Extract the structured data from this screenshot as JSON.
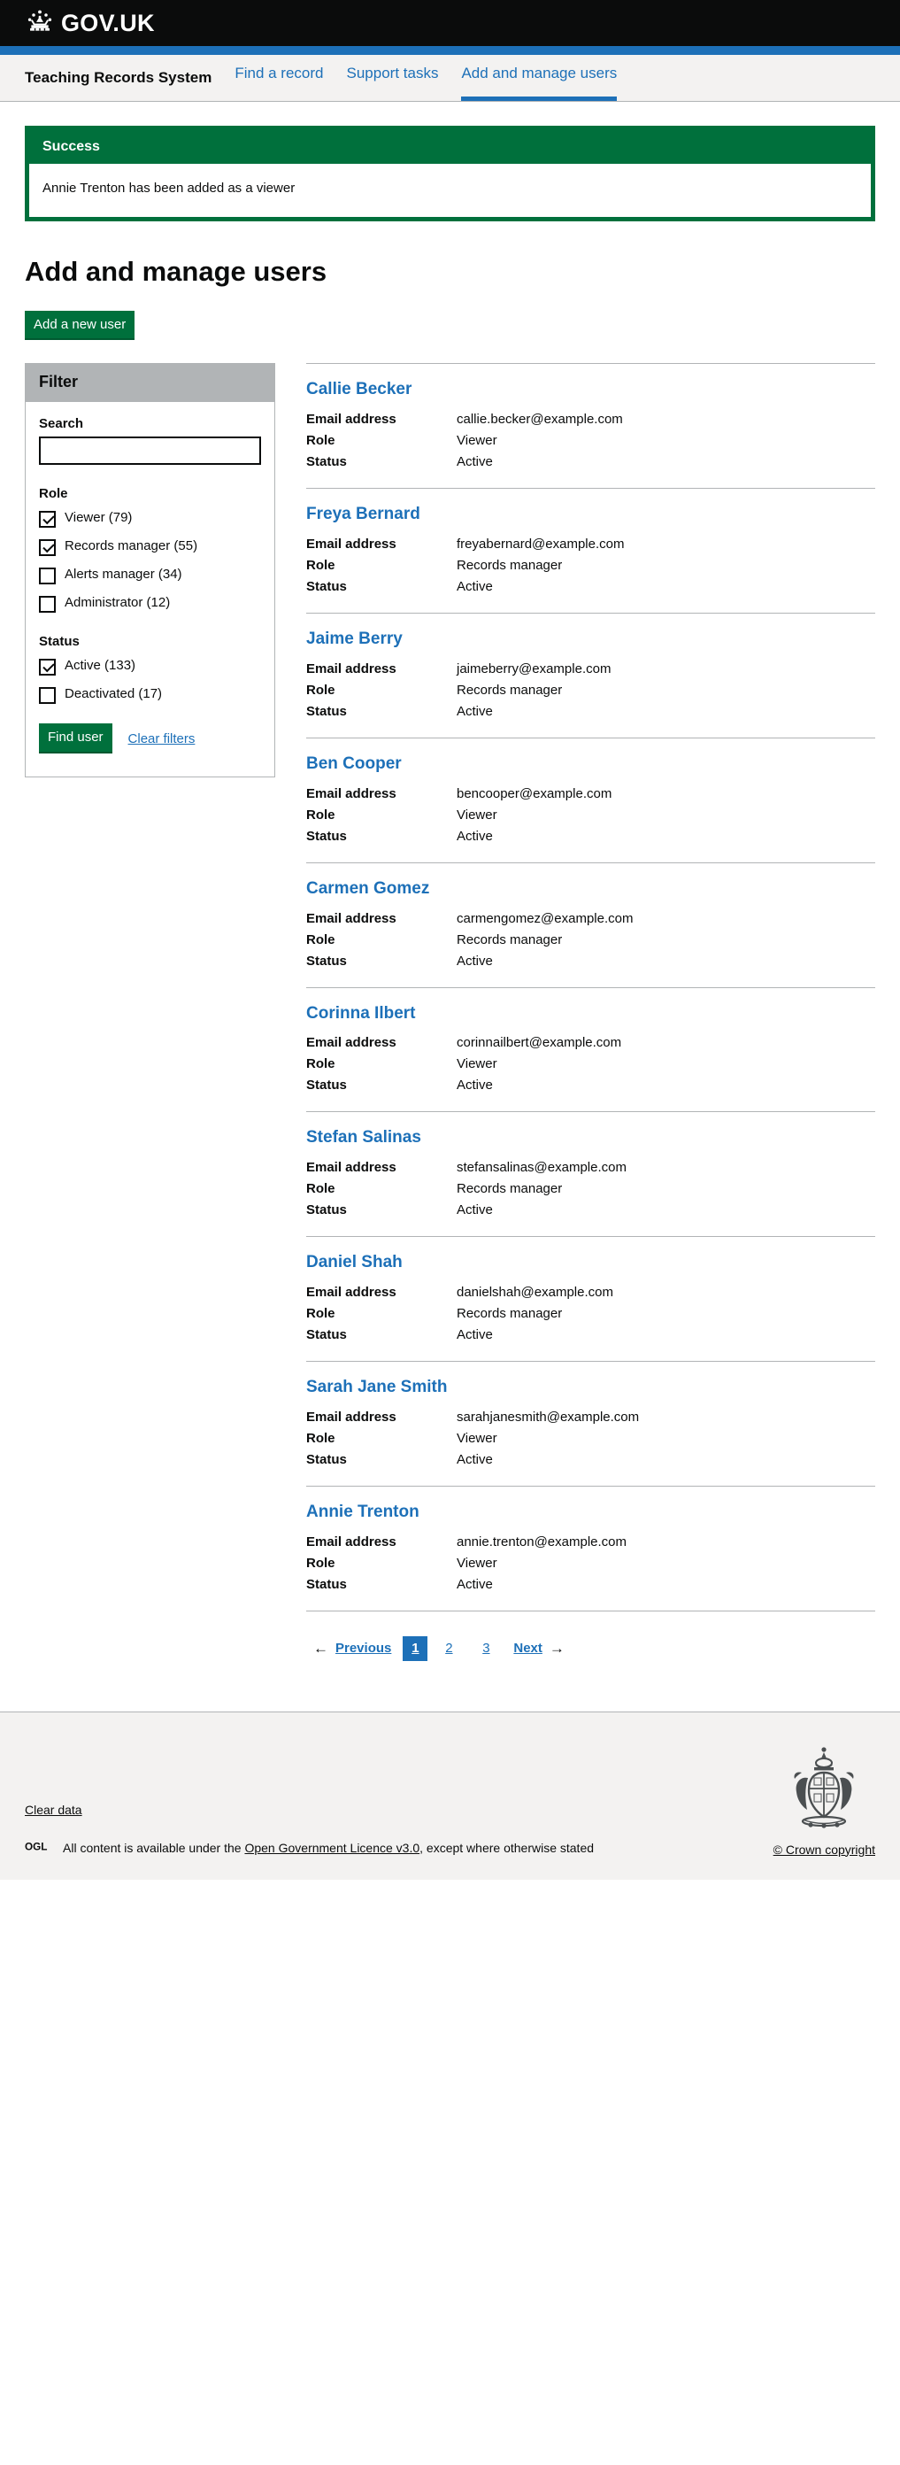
{
  "header": {
    "logo_text": "GOV.UK",
    "crown_icon": "crown-icon"
  },
  "service_nav": {
    "service_name": "Teaching Records System",
    "links": [
      {
        "label": "Find a record",
        "active": false
      },
      {
        "label": "Support tasks",
        "active": false
      },
      {
        "label": "Add and manage users",
        "active": true
      }
    ]
  },
  "notification": {
    "title": "Success",
    "message": "Annie Trenton has been added as a viewer",
    "border_color": "#00703c"
  },
  "page": {
    "title": "Add and manage users",
    "add_user_button": "Add a new user"
  },
  "filter": {
    "heading": "Filter",
    "search_label": "Search",
    "search_value": "",
    "search_placeholder": "",
    "role_group_title": "Role",
    "role_options": [
      {
        "label": "Viewer (79)",
        "checked": true
      },
      {
        "label": "Records manager (55)",
        "checked": true
      },
      {
        "label": "Alerts manager (34)",
        "checked": false
      },
      {
        "label": "Administrator (12)",
        "checked": false
      }
    ],
    "status_group_title": "Status",
    "status_options": [
      {
        "label": "Active (133)",
        "checked": true
      },
      {
        "label": "Deactivated (17)",
        "checked": false
      }
    ],
    "find_button": "Find user",
    "clear_link": "Clear filters"
  },
  "results": {
    "labels": {
      "email": "Email address",
      "role": "Role",
      "status": "Status"
    },
    "users": [
      {
        "name": "Callie Becker",
        "email": "callie.becker@example.com",
        "role": "Viewer",
        "status": "Active"
      },
      {
        "name": "Freya Bernard",
        "email": "freyabernard@example.com",
        "role": "Records manager",
        "status": "Active"
      },
      {
        "name": "Jaime Berry",
        "email": "jaimeberry@example.com",
        "role": "Records manager",
        "status": "Active"
      },
      {
        "name": "Ben Cooper",
        "email": "bencooper@example.com",
        "role": "Viewer",
        "status": "Active"
      },
      {
        "name": "Carmen Gomez",
        "email": "carmengomez@example.com",
        "role": "Records manager",
        "status": "Active"
      },
      {
        "name": "Corinna Ilbert",
        "email": "corinnailbert@example.com",
        "role": "Viewer",
        "status": "Active"
      },
      {
        "name": "Stefan Salinas",
        "email": "stefansalinas@example.com",
        "role": "Records manager",
        "status": "Active"
      },
      {
        "name": "Daniel Shah",
        "email": "danielshah@example.com",
        "role": "Records manager",
        "status": "Active"
      },
      {
        "name": "Sarah Jane Smith",
        "email": "sarahjanesmith@example.com",
        "role": "Viewer",
        "status": "Active"
      },
      {
        "name": "Annie Trenton",
        "email": "annie.trenton@example.com",
        "role": "Viewer",
        "status": "Active"
      }
    ]
  },
  "pagination": {
    "prev_arrow": "←",
    "prev_label": "Previous",
    "pages": [
      {
        "label": "1",
        "current": true
      },
      {
        "label": "2",
        "current": false
      },
      {
        "label": "3",
        "current": false
      }
    ],
    "next_label": "Next",
    "next_arrow": "→"
  },
  "footer": {
    "clear_data": "Clear data",
    "ogl_logo": "OGL",
    "licence_prefix": "All content is available under the ",
    "licence_link": "Open Government Licence v3.0",
    "licence_suffix": ", except where otherwise stated",
    "crown_copyright": "© Crown copyright",
    "crest_icon": "royal-crest-icon"
  }
}
